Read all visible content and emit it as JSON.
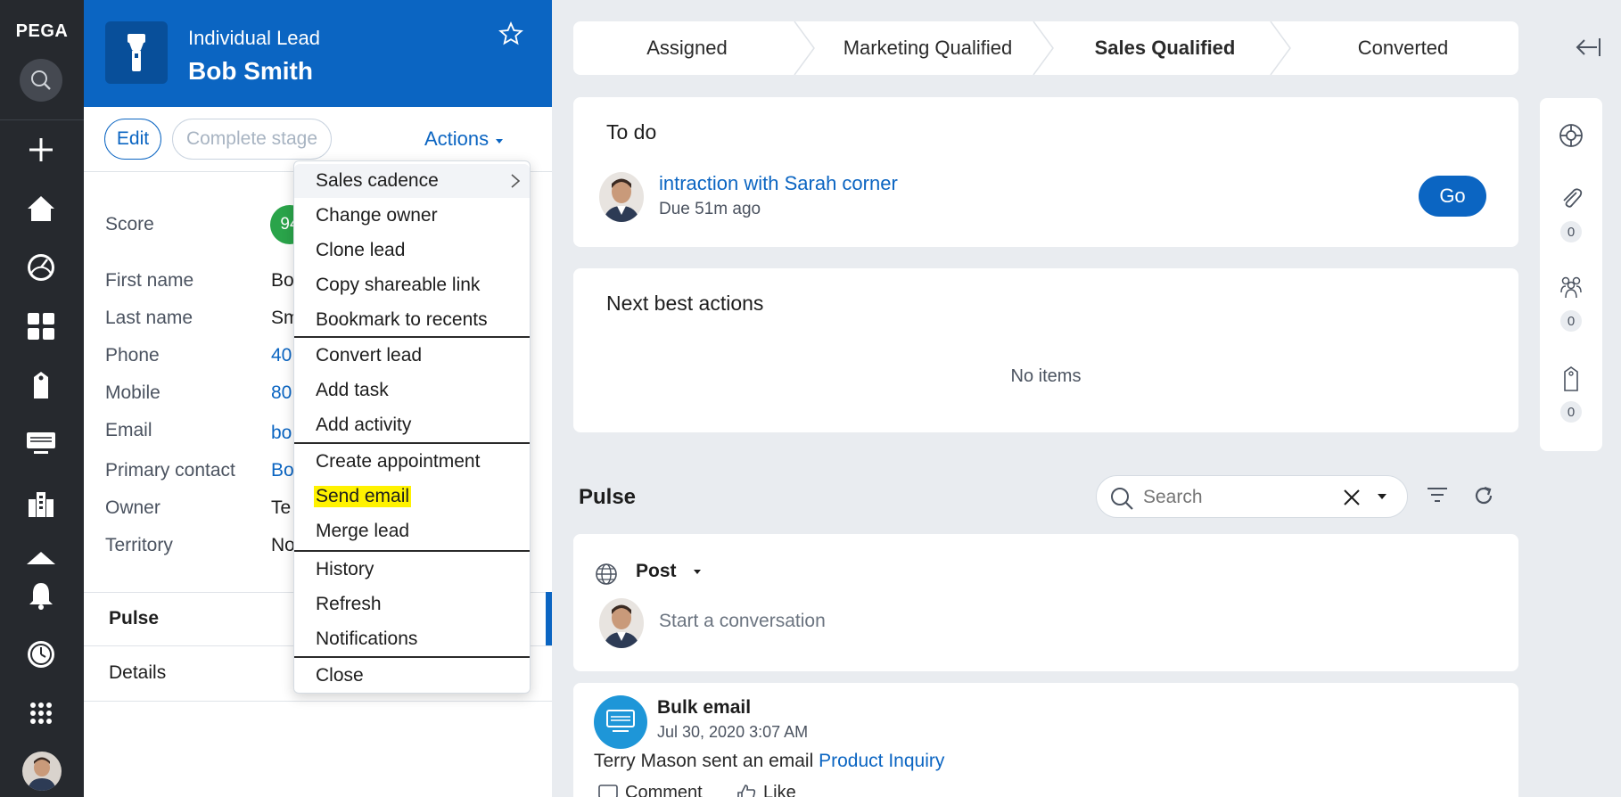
{
  "nav": {
    "logo": "PEGA",
    "icons": [
      "search-icon",
      "plus-icon",
      "home-icon",
      "dashboard-icon",
      "apps-icon",
      "tag-icon",
      "monitor-icon",
      "buildings-icon",
      "cloud-icon",
      "bell-icon",
      "history-icon",
      "grid-icon"
    ]
  },
  "header": {
    "type": "Individual Lead",
    "name": "Bob Smith"
  },
  "actions_bar": {
    "edit": "Edit",
    "complete_stage": "Complete stage",
    "actions": "Actions"
  },
  "fields": {
    "score_label": "Score",
    "score_value": "94",
    "first_name_label": "First name",
    "first_name_value": "Bo",
    "last_name_label": "Last name",
    "last_name_value": "Sm",
    "phone_label": "Phone",
    "phone_value": "40",
    "mobile_label": "Mobile",
    "mobile_value": "80",
    "email_label": "Email",
    "email_value": "bo",
    "primary_contact_label": "Primary contact",
    "primary_contact_value": "Bo",
    "owner_label": "Owner",
    "owner_value": "Te",
    "territory_label": "Territory",
    "territory_value": "No"
  },
  "tabs": {
    "pulse": "Pulse",
    "details": "Details"
  },
  "menu": {
    "items": [
      "Sales cadence",
      "Change owner",
      "Clone lead",
      "Copy shareable link",
      "Bookmark to recents",
      "Convert lead",
      "Add task",
      "Add activity",
      "Create appointment",
      "Send email",
      "Merge lead",
      "History",
      "Refresh",
      "Notifications",
      "Close"
    ]
  },
  "stages": {
    "s1": "Assigned",
    "s2": "Marketing Qualified",
    "s3": "Sales Qualified",
    "s4": "Converted"
  },
  "todo": {
    "title": "To do",
    "task": "intraction with Sarah corner",
    "due": "Due 51m ago",
    "go": "Go"
  },
  "nba": {
    "title": "Next best actions",
    "empty": "No items"
  },
  "pulse": {
    "title": "Pulse",
    "search_placeholder": "Search",
    "post_label": "Post",
    "post_placeholder": "Start a conversation"
  },
  "feed": {
    "title": "Bulk email",
    "date": "Jul 30, 2020 3:07 AM",
    "text": "Terry Mason sent an email ",
    "link": "Product Inquiry",
    "comment": "Comment",
    "like": "Like"
  },
  "rail": {
    "attachments": "0",
    "followers": "0",
    "tags": "0"
  },
  "colors": {
    "accent": "#0b65c2",
    "nav_bg": "#26292e",
    "score_green": "#2aa44a",
    "highlight": "#fff200"
  }
}
